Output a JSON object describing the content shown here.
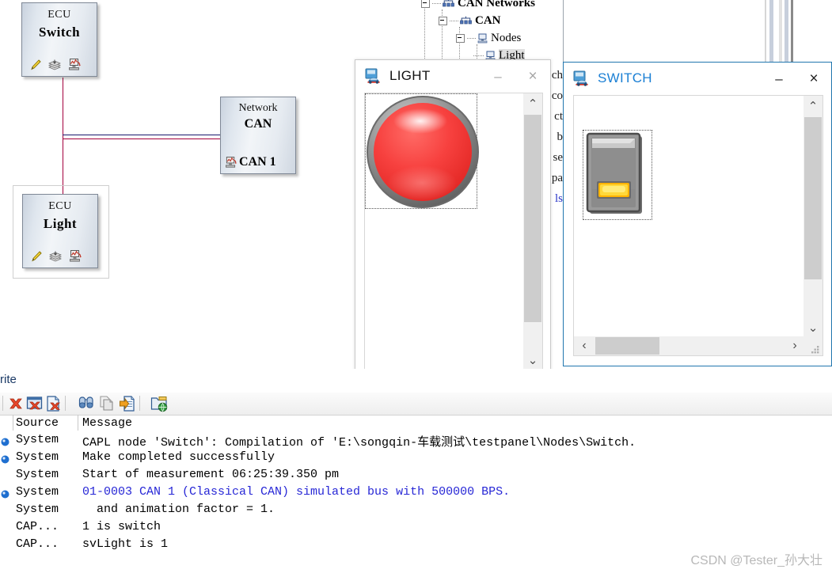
{
  "simulation_setup": {
    "ecus": [
      {
        "kind": "ECU",
        "name": "Switch",
        "selected": false
      },
      {
        "kind": "ECU",
        "name": "Light",
        "selected": true
      }
    ],
    "network": {
      "kind": "Network",
      "name": "CAN",
      "channel": "CAN 1"
    },
    "bus_line_colors": {
      "blue": "#1a1a6e",
      "red": "#a3003c"
    }
  },
  "tree": {
    "rows": [
      {
        "label": "CAN Networks",
        "bold": true,
        "selected": false
      },
      {
        "label": "CAN",
        "bold": true,
        "selected": false
      },
      {
        "label": "Nodes",
        "bold": false,
        "selected": false
      },
      {
        "label": "Light",
        "bold": false,
        "selected": true
      }
    ]
  },
  "obscured_text_column": {
    "lines": [
      "ch",
      "co",
      "ct",
      "b",
      "se",
      "pa",
      "ls"
    ],
    "blue_line_index": 6
  },
  "light_panel": {
    "title": "LIGHT",
    "icon": "panel-car-icon",
    "minimize_label": "–",
    "close_label": "×",
    "indicator": {
      "name": "light-indicator",
      "state": "on",
      "color": "#f23a3a"
    },
    "scroll_up_label": "⌃",
    "scroll_down_label": "⌄",
    "scroll_left_label": "‹",
    "scroll_right_label": "›"
  },
  "switch_panel": {
    "title": "SWITCH",
    "icon": "panel-car-icon",
    "minimize_label": "–",
    "close_label": "×",
    "title_color": "#1a7fd4",
    "control": {
      "name": "rocker-switch",
      "state": "on",
      "lamp_color": "#ffc400"
    },
    "scroll_up_label": "⌃",
    "scroll_down_label": "⌄",
    "scroll_left_label": "‹",
    "scroll_right_label": "›"
  },
  "write_window": {
    "tab_label": "rite",
    "toolbar_icons": [
      "clear-all-icon",
      "clear-window-icon",
      "clear-file-icon",
      "find-icon",
      "copy-icon",
      "export-icon",
      "open-folder-icon"
    ],
    "columns": [
      "Source",
      "Message"
    ],
    "rows": [
      {
        "bullet": true,
        "source": "System",
        "message": "CAPL node 'Switch': Compilation of 'E:\\songqin-车载测试\\testpanel\\Nodes\\Switch.",
        "blue": false
      },
      {
        "bullet": true,
        "source": "System",
        "message": "Make completed successfully",
        "blue": false
      },
      {
        "bullet": false,
        "source": "System",
        "message": "Start of measurement 06:25:39.350 pm",
        "blue": false
      },
      {
        "bullet": true,
        "source": "System",
        "message": "01-0003 CAN 1 (Classical CAN)  simulated bus with 500000 BPS.",
        "blue": true
      },
      {
        "bullet": false,
        "source": "System",
        "message": "  and animation factor = 1.",
        "blue": false
      },
      {
        "bullet": false,
        "source": "CAP...",
        "message": "1 is switch",
        "blue": false
      },
      {
        "bullet": false,
        "source": "CAP...",
        "message": "svLight is 1",
        "blue": false
      }
    ]
  },
  "watermark": {
    "text": "CSDN @Tester_孙大壮"
  }
}
